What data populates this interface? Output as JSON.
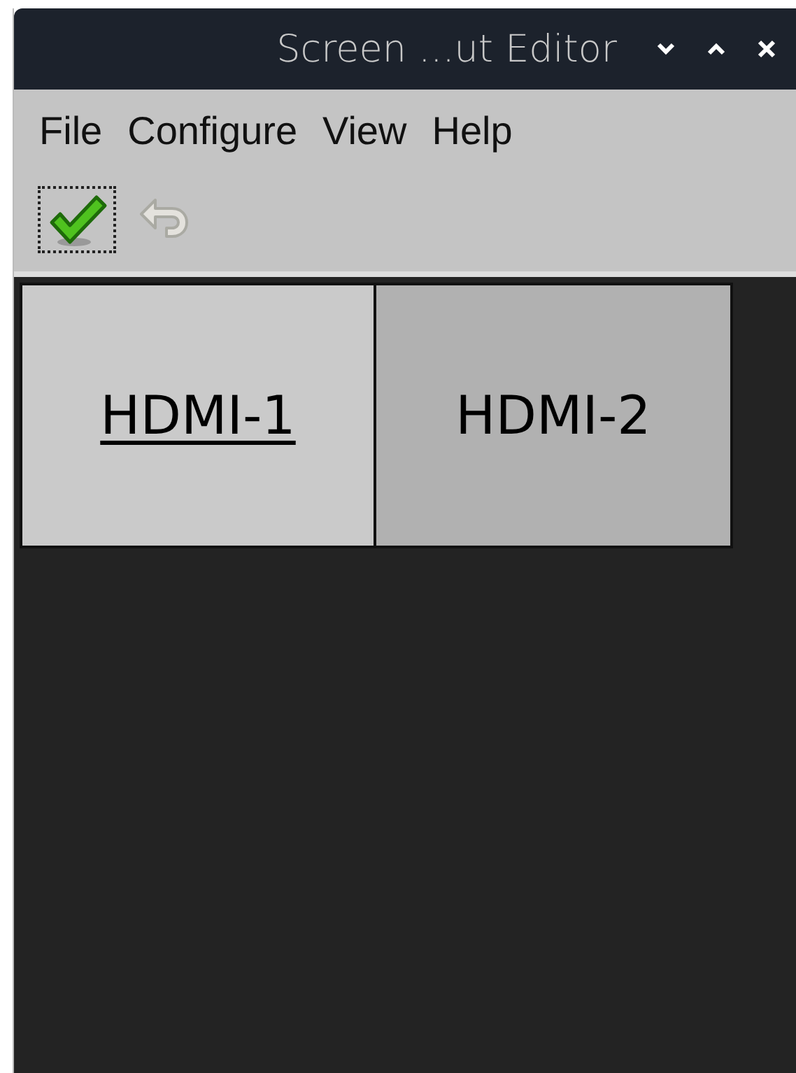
{
  "window": {
    "title": "Screen ...ut Editor"
  },
  "menu": [
    "File",
    "Configure",
    "View",
    "Help"
  ],
  "toolbar": [
    {
      "kind": "apply",
      "disabled": false,
      "focused": true
    },
    {
      "kind": "undo",
      "disabled": true,
      "focused": false
    }
  ],
  "monitors": [
    {
      "label": "HDMI-1",
      "selected": true
    },
    {
      "label": "HDMI-2",
      "selected": false
    }
  ]
}
